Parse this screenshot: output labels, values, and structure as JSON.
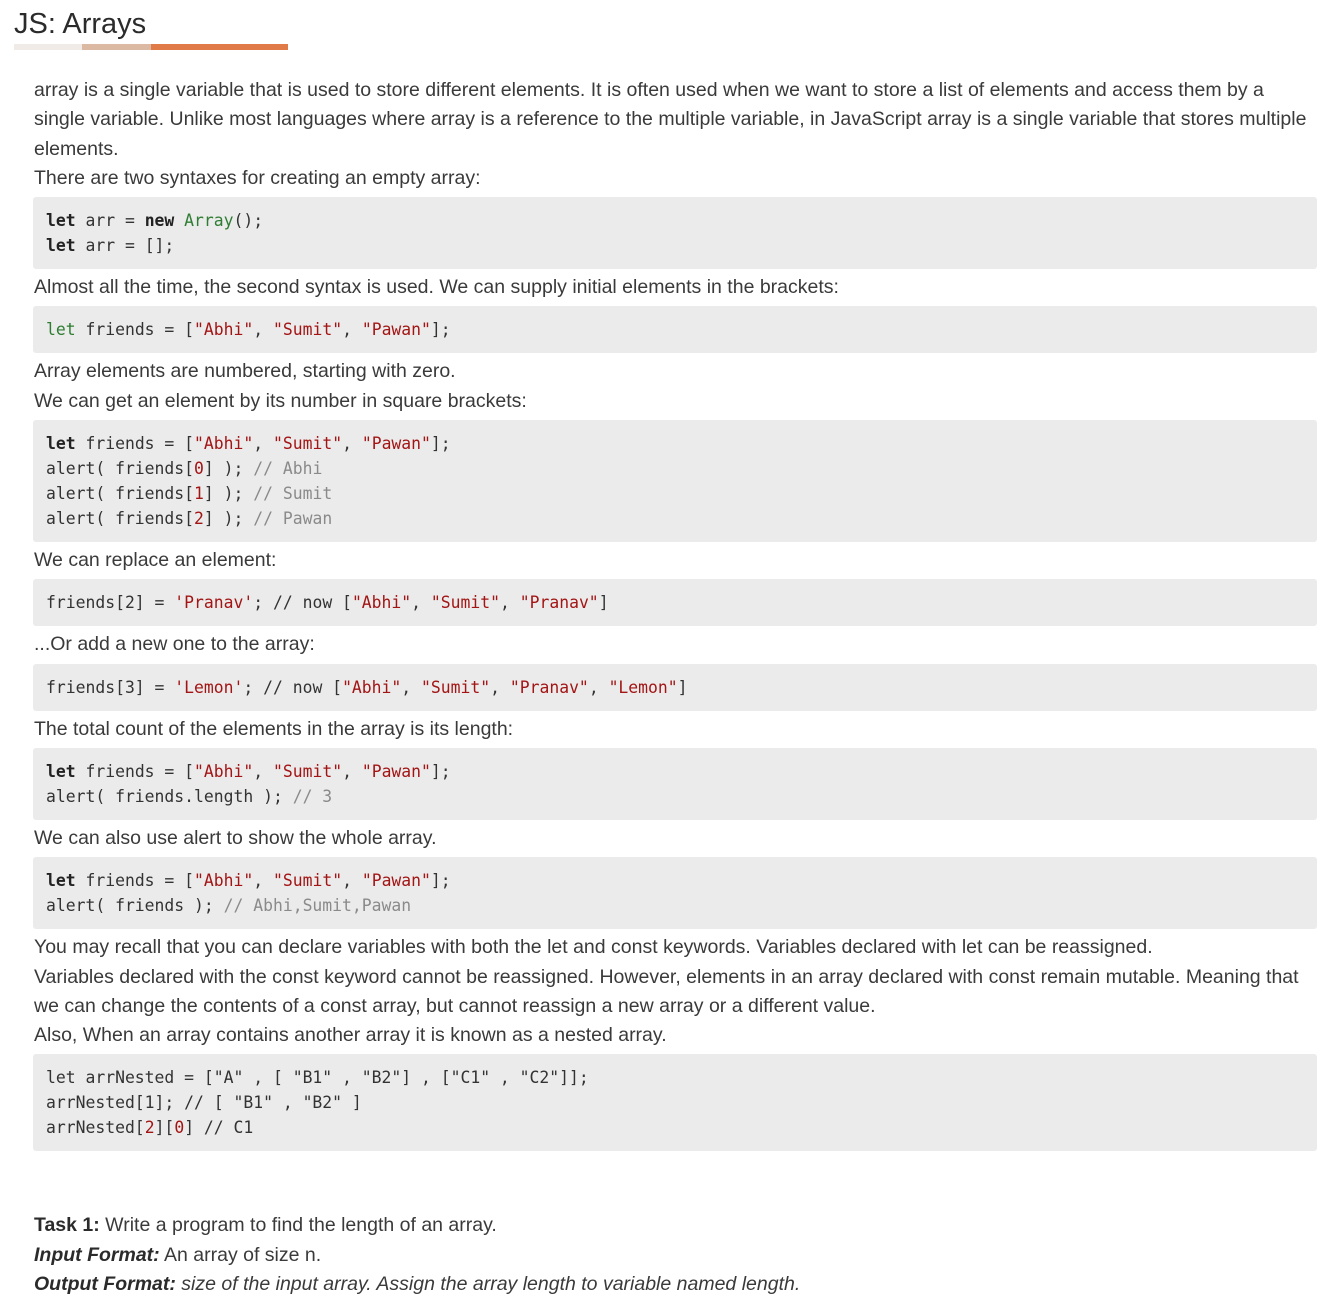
{
  "page": {
    "title": "JS: Arrays",
    "intro": "array is a single variable that is used to store different elements. It is often used when we want to store a list of elements and access them by a single variable. Unlike most languages where array is a reference to the multiple variable, in JavaScript array is a single variable that stores multiple elements.",
    "p_two_syntaxes": "There are two syntaxes for creating an empty array:",
    "p_second_syntax": "Almost all the time, the second syntax is used. We can supply initial elements in the brackets:",
    "p_numbered": "Array elements are numbered, starting with zero.",
    "p_get_element": "We can get an element by its number in square brackets:",
    "p_replace": "We can replace an element:",
    "p_add": "...Or add a new one to the array:",
    "p_length": "The total count of the elements in the array is its length:",
    "p_alert_whole": "We can also use alert to show the whole array.",
    "p_recall_1": "You may recall that you can declare variables with both the let and const keywords. Variables declared with let can be reassigned.",
    "p_recall_2": "Variables declared with the const keyword cannot be reassigned. However, elements in an array declared with const remain mutable. Meaning that we can change the contents of a const array, but cannot reassign a new array or a different value.",
    "p_nested": "Also, When an array contains another array it is known as a nested array."
  },
  "tokens": {
    "let": "let",
    "new": "new",
    "Array": "Array",
    "arr": " arr = ",
    "arr_tail_new": "();",
    "arr_tail_lit": "[];",
    "friends_eq": " friends = [",
    "abhi": "\"Abhi\"",
    "sumit": "\"Sumit\"",
    "pawan": "\"Pawan\"",
    "pranav": "\"Pranav\"",
    "lemon": "\"Lemon\"",
    "comma": ", ",
    "close_semi": "];",
    "close": "]",
    "alert_friends": "alert( friends[",
    "alert_close": "] ); ",
    "idx0": "0",
    "idx1": "1",
    "idx2": "2",
    "c_abhi": "// Abhi",
    "c_sumit": "// Sumit",
    "c_pawan": "// Pawan",
    "friends2": "friends[2] = ",
    "friends3": "friends[3] = ",
    "s_pranav": "'Pranav'",
    "s_lemon": "'Lemon'",
    "now": "; // now [",
    "alert_len": "alert( friends.length ); ",
    "c_3": "// 3",
    "alert_whole": "alert( friends ); ",
    "c_whole": "// Abhi,Sumit,Pawan",
    "nested_1": "let arrNested = [\"A\" , [ \"B1\" , \"B2\"] , [\"C1\" , \"C2\"]];",
    "nested_2": "arrNested[1]; // [ \"B1\" , \"B2\" ]",
    "nested_3a": "arrNested[",
    "nested_3b": "][",
    "nested_3c": "] // C1"
  },
  "task": {
    "label": "Task 1:",
    "text": " Write a program to find the length of an array.",
    "input_label": "Input Format:",
    "input_text": " An array of size n.",
    "output_label": "Output Format:",
    "output_text": " size of the input array. Assign the array length to variable named length."
  }
}
